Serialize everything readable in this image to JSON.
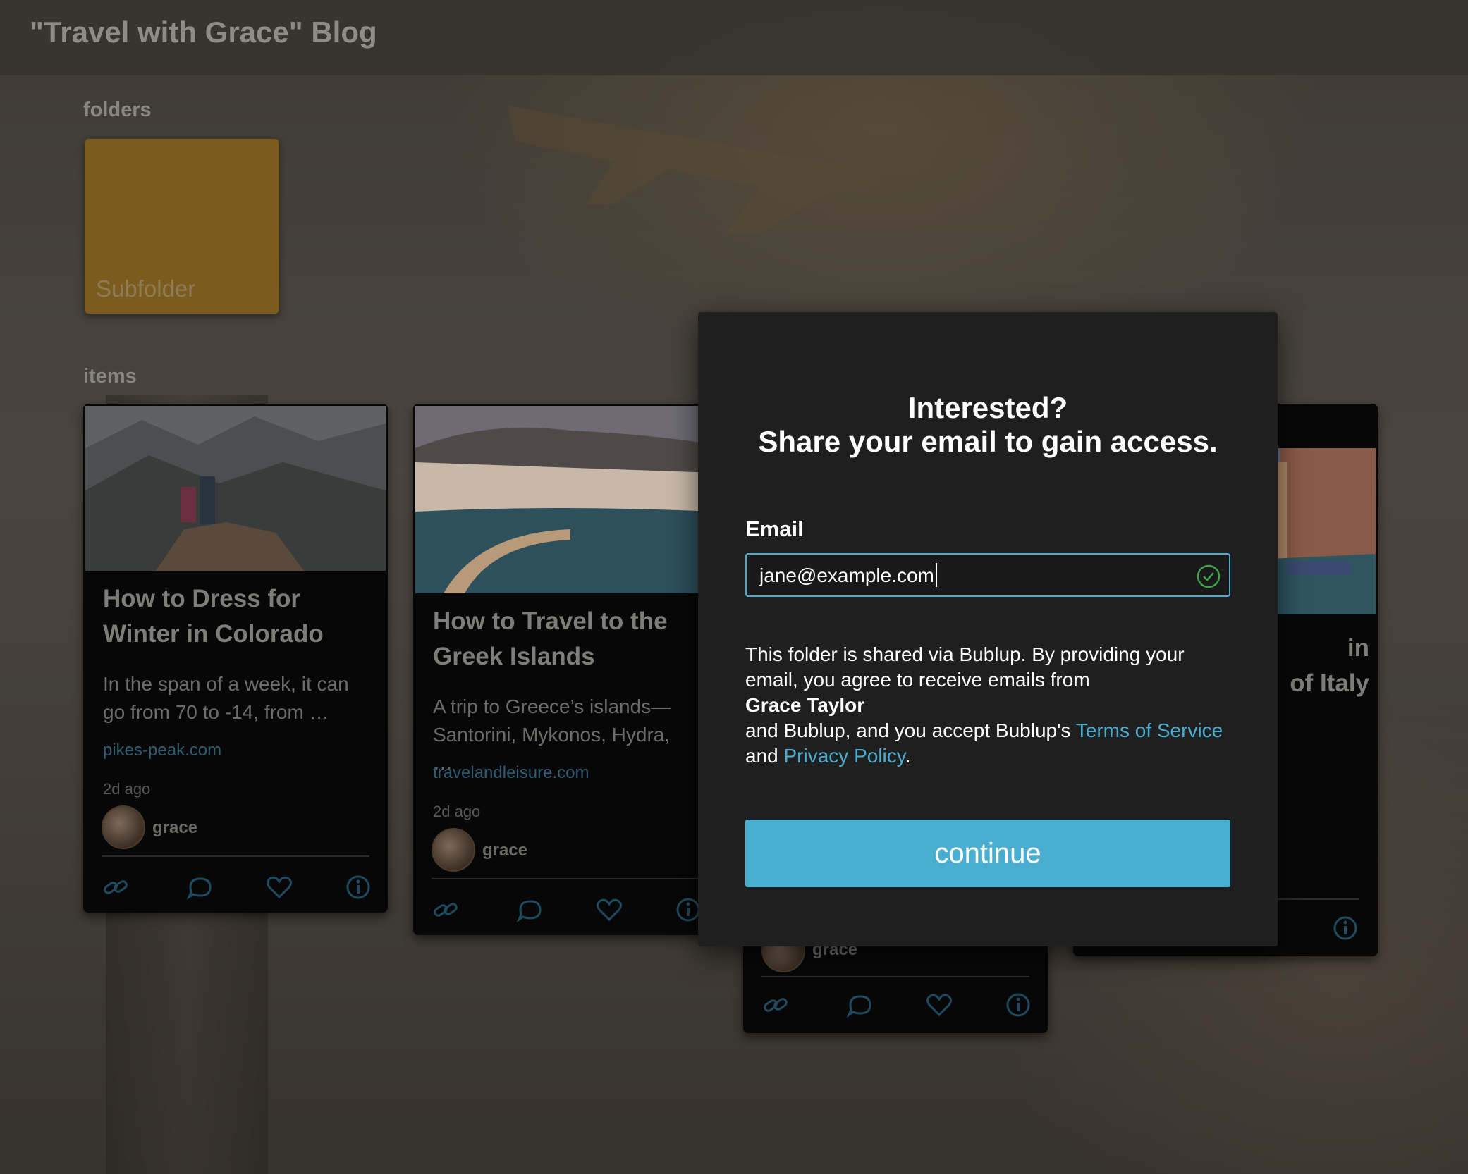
{
  "header": {
    "title": "\"Travel with Grace\" Blog"
  },
  "folders": {
    "label": "folders",
    "items": [
      {
        "name": "Subfolder",
        "color": "#7c5b1e"
      }
    ]
  },
  "items": {
    "label": "items",
    "cards": [
      {
        "title": "How to Dress for Winter in Colorado",
        "description": "In the span of a week, it can go from 70 to -14, from …",
        "source": "pikes-peak.com",
        "time": "2d ago",
        "author": "grace"
      },
      {
        "title": "How to Travel to the Greek Islands",
        "description": "A trip to Greece’s islands—Santorini, Mykonos, Hydra, …",
        "source": "travelandleisure.com",
        "time": "2d ago",
        "author": "grace"
      },
      {
        "title": "",
        "description": "",
        "source": "",
        "time": "",
        "author": "grace"
      },
      {
        "title": "in\nof Italy",
        "description": "",
        "source": "",
        "time": "",
        "author": ""
      }
    ],
    "actions": [
      "link-icon",
      "comment-icon",
      "heart-icon",
      "info-icon"
    ]
  },
  "modal": {
    "heading_line1": "Interested?",
    "heading_line2": "Share your email to gain access.",
    "email_label": "Email",
    "email_value": "jane@example.com",
    "terms_part1": "This folder is shared via Bublup. By providing your email, you agree to receive emails from",
    "terms_name": "Grace Taylor",
    "terms_part2": "and Bublup, and you accept Bublup's",
    "terms_link": "Terms of Service",
    "terms_and": "and",
    "privacy_link": "Privacy Policy",
    "terms_period": ".",
    "continue_label": "continue",
    "accent_color": "#4aaed1",
    "valid_color": "#3fa34d"
  }
}
